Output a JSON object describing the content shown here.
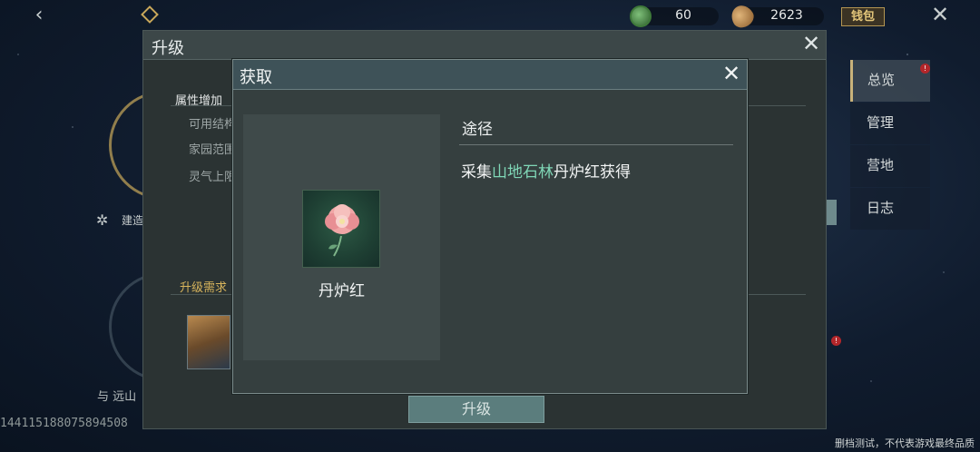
{
  "topbar": {
    "back_icon": "chevron-left-icon",
    "currency_1": {
      "icon": "jade-coin-icon",
      "value": "60"
    },
    "currency_2": {
      "icon": "seed-icon",
      "value": "2623"
    },
    "bag_label": "钱包"
  },
  "right_nav": {
    "items": [
      {
        "label": "总览",
        "active": true,
        "badge": "!"
      },
      {
        "label": "管理"
      },
      {
        "label": "营地"
      },
      {
        "label": "日志"
      }
    ]
  },
  "background": {
    "build_label": "建造",
    "yu_label": "与 远山",
    "side_badge": "!"
  },
  "upgrade_panel": {
    "title": "升级",
    "attr_title": "属性增加",
    "attrs": [
      "可用结构",
      "家园范围",
      "灵气上限"
    ],
    "req_title": "升级需求",
    "upgrade_button": "升级"
  },
  "get_dialog": {
    "title": "获取",
    "item_name": "丹炉红",
    "route_title": "途径",
    "route_prefix": "采集",
    "route_highlight": "山地石林",
    "route_suffix": "丹炉红获得"
  },
  "footer": {
    "id_text": "14411518807589450​8",
    "disclaimer": "删档测试，不代表游戏最终品质"
  },
  "colors": {
    "accent_gold": "#c9a85a",
    "highlight_green": "#7fd6b6",
    "badge_red": "#b3262a"
  }
}
